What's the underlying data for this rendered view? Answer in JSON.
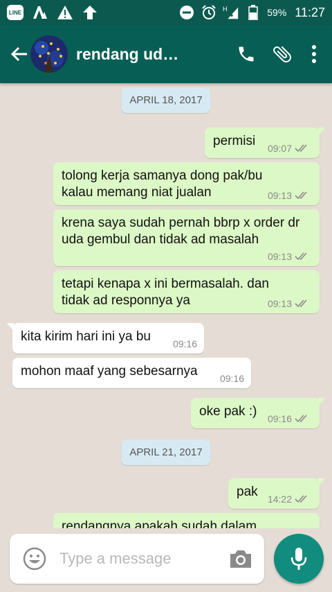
{
  "status_bar": {
    "line_label": "LINE",
    "network": "H",
    "battery": "59%",
    "time": "11:27"
  },
  "header": {
    "contact_name": "rendang ud…",
    "icons": [
      "back-arrow-icon",
      "phone-icon",
      "paperclip-icon",
      "more-vert-icon"
    ]
  },
  "chat": {
    "dates": [
      "APRIL 18, 2017",
      "APRIL 21, 2017"
    ],
    "messages": [
      {
        "dir": "out",
        "lines": [
          "permisi"
        ],
        "time": "09:07"
      },
      {
        "dir": "out",
        "lines": [
          "tolong kerja samanya dong pak/bu",
          "kalau memang niat jualan"
        ],
        "time": "09:13"
      },
      {
        "dir": "out",
        "lines": [
          "krena saya sudah pernah bbrp x order dr",
          "uda gembul dan tidak ad masalah"
        ],
        "time": "09:13"
      },
      {
        "dir": "out",
        "lines": [
          "tetapi kenapa x ini bermasalah. dan",
          "tidak ad responnya ya"
        ],
        "time": "09:13"
      },
      {
        "dir": "in",
        "lines": [
          "kita kirim hari ini ya bu"
        ],
        "time": "09:16"
      },
      {
        "dir": "in",
        "lines": [
          "mohon maaf yang sebesarnya"
        ],
        "time": "09:16"
      },
      {
        "dir": "out",
        "lines": [
          "oke pak :)"
        ],
        "time": "09:16"
      },
      {
        "dir": "out",
        "lines": [
          "pak"
        ],
        "time": "14:22"
      },
      {
        "dir": "out",
        "lines": [
          "rendangnya apakah sudah dalam"
        ],
        "time": ""
      }
    ]
  },
  "input": {
    "placeholder": "Type a message"
  },
  "colors": {
    "appbar": "#075e54",
    "statusbar": "#0c5a4f",
    "outgoing_bubble": "#dcf8c6",
    "incoming_bubble": "#ffffff",
    "date_chip": "#d7eaf3",
    "mic_button": "#128c7e"
  }
}
